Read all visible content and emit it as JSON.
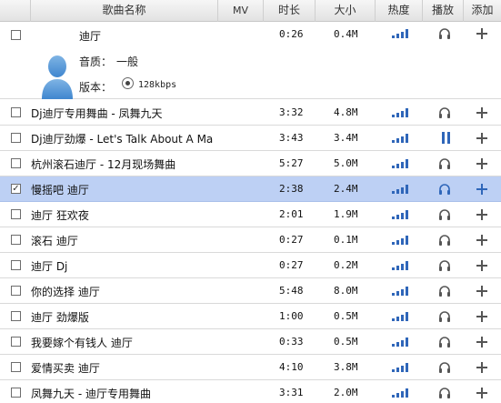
{
  "headers": {
    "name": "歌曲名称",
    "mv": "MV",
    "duration": "时长",
    "size": "大小",
    "heat": "热度",
    "play": "播放",
    "add": "添加"
  },
  "expanded": {
    "title": "迪厅",
    "duration": "0:26",
    "size": "0.4M",
    "quality_label": "音质：",
    "quality_value": "一般",
    "version_label": "版本：",
    "version_value": "128kbps"
  },
  "rows": [
    {
      "title": "Dj迪厅专用舞曲 - 凤舞九天",
      "duration": "3:32",
      "size": "4.8M",
      "selected": false,
      "checked": false,
      "playing": false
    },
    {
      "title": "Dj迪厅劲爆 - Let's Talk About A Ma",
      "duration": "3:43",
      "size": "3.4M",
      "selected": false,
      "checked": false,
      "playing": true
    },
    {
      "title": "杭州滚石迪厅 - 12月现场舞曲",
      "duration": "5:27",
      "size": "5.0M",
      "selected": false,
      "checked": false,
      "playing": false
    },
    {
      "title": "慢摇吧 迪厅",
      "duration": "2:38",
      "size": "2.4M",
      "selected": true,
      "checked": true,
      "playing": false
    },
    {
      "title": "迪厅 狂欢夜",
      "duration": "2:01",
      "size": "1.9M",
      "selected": false,
      "checked": false,
      "playing": false
    },
    {
      "title": "滚石 迪厅",
      "duration": "0:27",
      "size": "0.1M",
      "selected": false,
      "checked": false,
      "playing": false
    },
    {
      "title": "迪厅 Dj",
      "duration": "0:27",
      "size": "0.2M",
      "selected": false,
      "checked": false,
      "playing": false
    },
    {
      "title": "你的选择 迪厅",
      "duration": "5:48",
      "size": "8.0M",
      "selected": false,
      "checked": false,
      "playing": false
    },
    {
      "title": "迪厅 劲爆版",
      "duration": "1:00",
      "size": "0.5M",
      "selected": false,
      "checked": false,
      "playing": false
    },
    {
      "title": "我要嫁个有钱人 迪厅",
      "duration": "0:33",
      "size": "0.5M",
      "selected": false,
      "checked": false,
      "playing": false
    },
    {
      "title": "爱情买卖 迪厅",
      "duration": "4:10",
      "size": "3.8M",
      "selected": false,
      "checked": false,
      "playing": false
    },
    {
      "title": "凤舞九天 - 迪厅专用舞曲",
      "duration": "3:31",
      "size": "2.0M",
      "selected": false,
      "checked": false,
      "playing": false
    }
  ],
  "colors": {
    "selected_row": "#bdd0f4",
    "accent_blue": "#2f66b9",
    "icon_gray": "#555555"
  },
  "icons": {
    "heat": "signal-bars-icon",
    "play": "headphone-icon",
    "playing": "pause-icon",
    "add": "plus-icon",
    "avatar": "user-silhouette-icon"
  }
}
